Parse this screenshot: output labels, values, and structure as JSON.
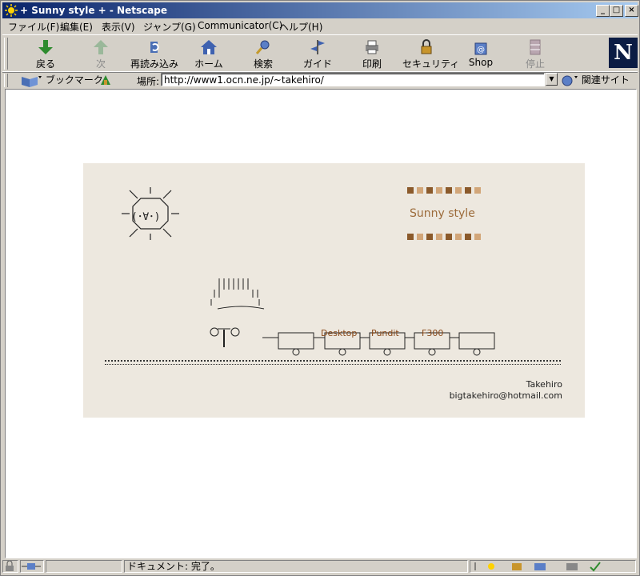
{
  "window": {
    "title": "+ Sunny style + - Netscape",
    "minimize": "_",
    "maximize": "□",
    "close": "×"
  },
  "menu": [
    "ファイル(F)",
    "編集(E)",
    "表示(V)",
    "ジャンプ(G)",
    "Communicator(C)",
    "ヘルプ(H)"
  ],
  "toolbar": {
    "back": "戻る",
    "forward": "次",
    "reload": "再読み込み",
    "home": "ホーム",
    "search": "検索",
    "guide": "ガイド",
    "print": "印刷",
    "security": "セキュリティ",
    "shop": "Shop",
    "stop": "停止"
  },
  "logo": "N",
  "location": {
    "bookmarks": "ブックマーク",
    "label": "場所:",
    "url": "http://www1.ocn.ne.jp/~takehiro/",
    "related": "関連サイト"
  },
  "page": {
    "site_title": "Sunny style",
    "sun_face": "(･∀･)",
    "links": [
      "Desktop",
      "Pundit",
      "F300"
    ],
    "author": "Takehiro",
    "email": "bigtakehiro@hotmail.com",
    "colors": {
      "panel_bg": "#ede8df",
      "accent": "#9c6b3a",
      "square_dark": "#8b5a2b",
      "square_light": "#d2a679"
    }
  },
  "status": {
    "text": "ドキュメント: 完了。"
  }
}
